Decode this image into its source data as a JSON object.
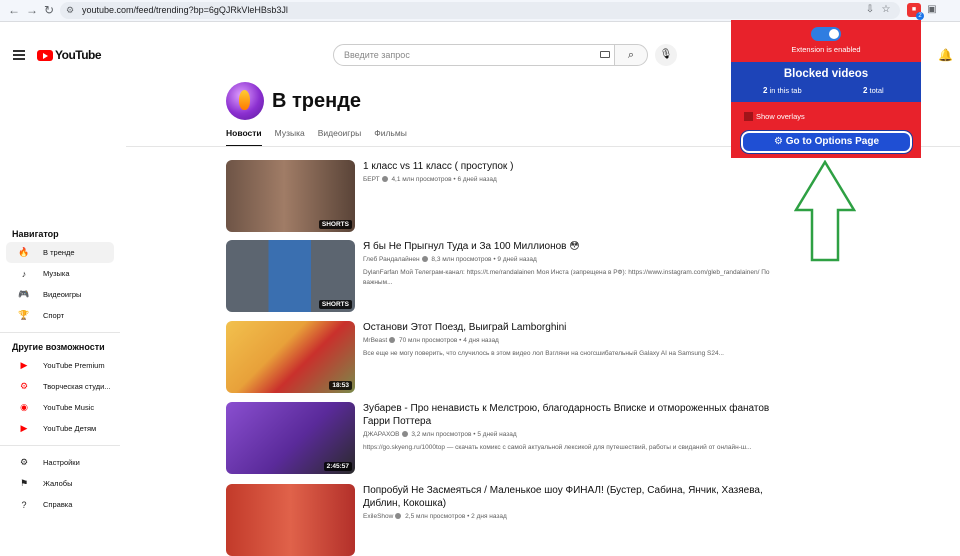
{
  "browser": {
    "url": "youtube.com/feed/trending?bp=6gQJRkVleHBsb3Jl",
    "extension_badge_count": "2"
  },
  "header": {
    "logo_text": "YouTube",
    "search_placeholder": "Введите запрос"
  },
  "sidebar": {
    "navigator_heading": "Навигатор",
    "nav_items": [
      {
        "label": "В тренде",
        "icon": "trending-icon"
      },
      {
        "label": "Музыка",
        "icon": "music-icon"
      },
      {
        "label": "Видеоигры",
        "icon": "gaming-icon"
      },
      {
        "label": "Спорт",
        "icon": "sports-icon"
      }
    ],
    "more_heading": "Другие возможности",
    "more_items": [
      {
        "label": "YouTube Premium"
      },
      {
        "label": "Творческая студи..."
      },
      {
        "label": "YouTube Music"
      },
      {
        "label": "YouTube Детям"
      }
    ],
    "bottom_items": [
      {
        "label": "Настройки",
        "icon": "settings-icon"
      },
      {
        "label": "Жалобы",
        "icon": "flag-icon"
      },
      {
        "label": "Справка",
        "icon": "help-icon"
      }
    ]
  },
  "trending": {
    "title": "В тренде",
    "tabs": [
      "Новости",
      "Музыка",
      "Видеоигры",
      "Фильмы"
    ]
  },
  "videos": [
    {
      "title": "1 класс vs 11 класс ( проступок )",
      "channel": "БЕРТ",
      "views": "4,1 млн просмотров",
      "age": "6 дней назад",
      "description": "",
      "badge": "SHORTS",
      "thumb_color": "#8a6b5a"
    },
    {
      "title": "Я бы Не Прыгнул Туда и За 100 Миллионов 😳",
      "channel": "Глеб Рандалайнен",
      "views": "8,3 млн просмотров",
      "age": "9 дней назад",
      "description": "DylanFarfan Мой Телеграм-канал: https://t.me/randalainen Моя Инста (запрещена в РФ): https://www.instagram.com/gleb_randalainen/ По важным...",
      "badge": "SHORTS",
      "thumb_color": "#5e6a78"
    },
    {
      "title": "Останови Этот Поезд, Выиграй Lamborghini",
      "channel": "MrBeast",
      "views": "70 млн просмотров",
      "age": "4 дня назад",
      "description": "Все еще не могу поверить, что случилось в этом видео лол Взгляни на сногсшибательный Galaxy AI на Samsung S24...",
      "badge": "18:53",
      "thumb_color": "#d9a23a"
    },
    {
      "title": "Зубарев - Про ненависть к Мелстрою, благодарность Вписке и отмороженных фанатов Гарри Поттера",
      "channel": "ДЖАРАХОВ",
      "views": "3,2 млн просмотров",
      "age": "5 дней назад",
      "description": "https://go.skyeng.ru/1000top — скачать комикс с самой актуальной лексикой для путешествий, работы и свиданий от онлайн-ш...",
      "badge": "2:45:57",
      "thumb_color": "#6b3fa0"
    },
    {
      "title": "Попробуй Не Засмеяться / Маленькое шоу ФИНАЛ! (Бустер, Сабина, Янчик, Хазяева, Диблин, Кокошка)",
      "channel": "ExileShow",
      "views": "2,5 млн просмотров",
      "age": "2 дня назад",
      "description": "",
      "badge": "",
      "thumb_color": "#c23a2a"
    }
  ],
  "extension": {
    "status": "Extension is enabled",
    "blocked_title": "Blocked videos",
    "in_tab_count": "2",
    "in_tab_label": "in this tab",
    "total_count": "2",
    "total_label": "total",
    "overlay_label": "Show overlays",
    "options_button": "Go to Options Page",
    "colors": {
      "popup_bg": "#e8222b",
      "blocked_bg": "#1d44b8",
      "arrow": "#2ea043"
    }
  }
}
